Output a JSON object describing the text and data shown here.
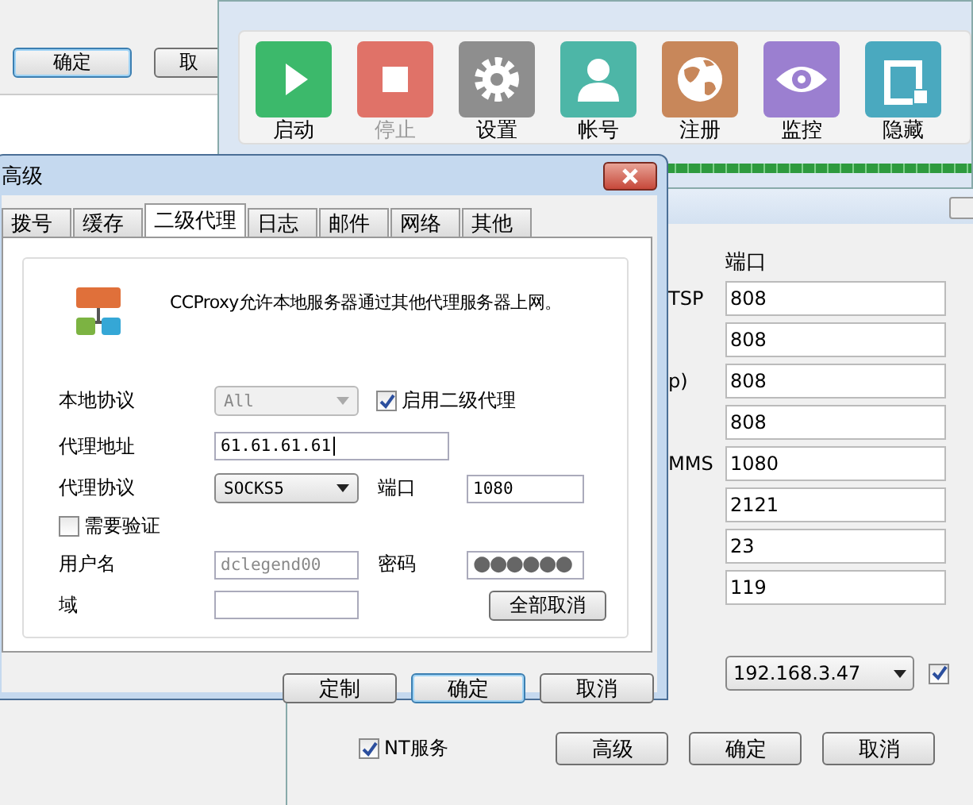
{
  "back_window": {
    "buttons": [
      {
        "label": "确定",
        "default": true
      },
      {
        "label": "取",
        "default": false
      }
    ]
  },
  "main_window": {
    "toolbar": [
      {
        "label": "启动",
        "disabled": false,
        "color": "#3cb96b"
      },
      {
        "label": "停止",
        "disabled": true,
        "color": "#e07268"
      },
      {
        "label": "设置",
        "disabled": false,
        "color": "#8e8e8e"
      },
      {
        "label": "帐号",
        "disabled": false,
        "color": "#4db6a7"
      },
      {
        "label": "注册",
        "disabled": false,
        "color": "#c8875a"
      },
      {
        "label": "监控",
        "disabled": false,
        "color": "#9b7fd0"
      },
      {
        "label": "隐藏",
        "disabled": false,
        "color": "#4aa9bf"
      }
    ]
  },
  "settings_window": {
    "port_header": "端口",
    "rows": [
      {
        "label": "TSP",
        "port": "808"
      },
      {
        "port": "808"
      },
      {
        "label": "p)",
        "port": "808"
      },
      {
        "port": "808"
      },
      {
        "label": "MMS",
        "port": "1080"
      },
      {
        "port": "2121"
      },
      {
        "port": "23"
      },
      {
        "port": "119"
      }
    ],
    "ip_select": {
      "value": "192.168.3.47",
      "checked": true
    },
    "nt_service": {
      "label": "NT服务",
      "checked": true
    },
    "buttons": [
      {
        "label": "高级",
        "default": false
      },
      {
        "label": "确定",
        "default": false
      },
      {
        "label": "取消",
        "default": false
      }
    ]
  },
  "dialog": {
    "title": "高级",
    "tabs": [
      {
        "label": "拨号",
        "selected": false
      },
      {
        "label": "缓存",
        "selected": false
      },
      {
        "label": "二级代理",
        "selected": true
      },
      {
        "label": "日志",
        "selected": false
      },
      {
        "label": "邮件",
        "selected": false
      },
      {
        "label": "网络",
        "selected": false
      },
      {
        "label": "其他",
        "selected": false
      }
    ],
    "description": "CCProxy允许本地服务器通过其他代理服务器上网。",
    "local_protocol": {
      "label": "本地协议",
      "value": "All",
      "disabled": true
    },
    "enable_proxy": {
      "label": "启用二级代理",
      "checked": true
    },
    "proxy_address": {
      "label": "代理地址",
      "value": "61.61.61.61"
    },
    "proxy_protocol": {
      "label": "代理协议",
      "value": "SOCKS5"
    },
    "port": {
      "label": "端口",
      "value": "1080"
    },
    "auth": {
      "label": "需要验证",
      "checked": false
    },
    "username": {
      "label": "用户名",
      "value": "dclegend00",
      "disabled": true
    },
    "password": {
      "label": "密码",
      "value": "●●●●●●"
    },
    "domain": {
      "label": "域"
    },
    "clear_button": "全部取消",
    "buttons": [
      {
        "label": "定制",
        "default": false
      },
      {
        "label": "确定",
        "default": true
      },
      {
        "label": "取消",
        "default": false
      }
    ]
  }
}
